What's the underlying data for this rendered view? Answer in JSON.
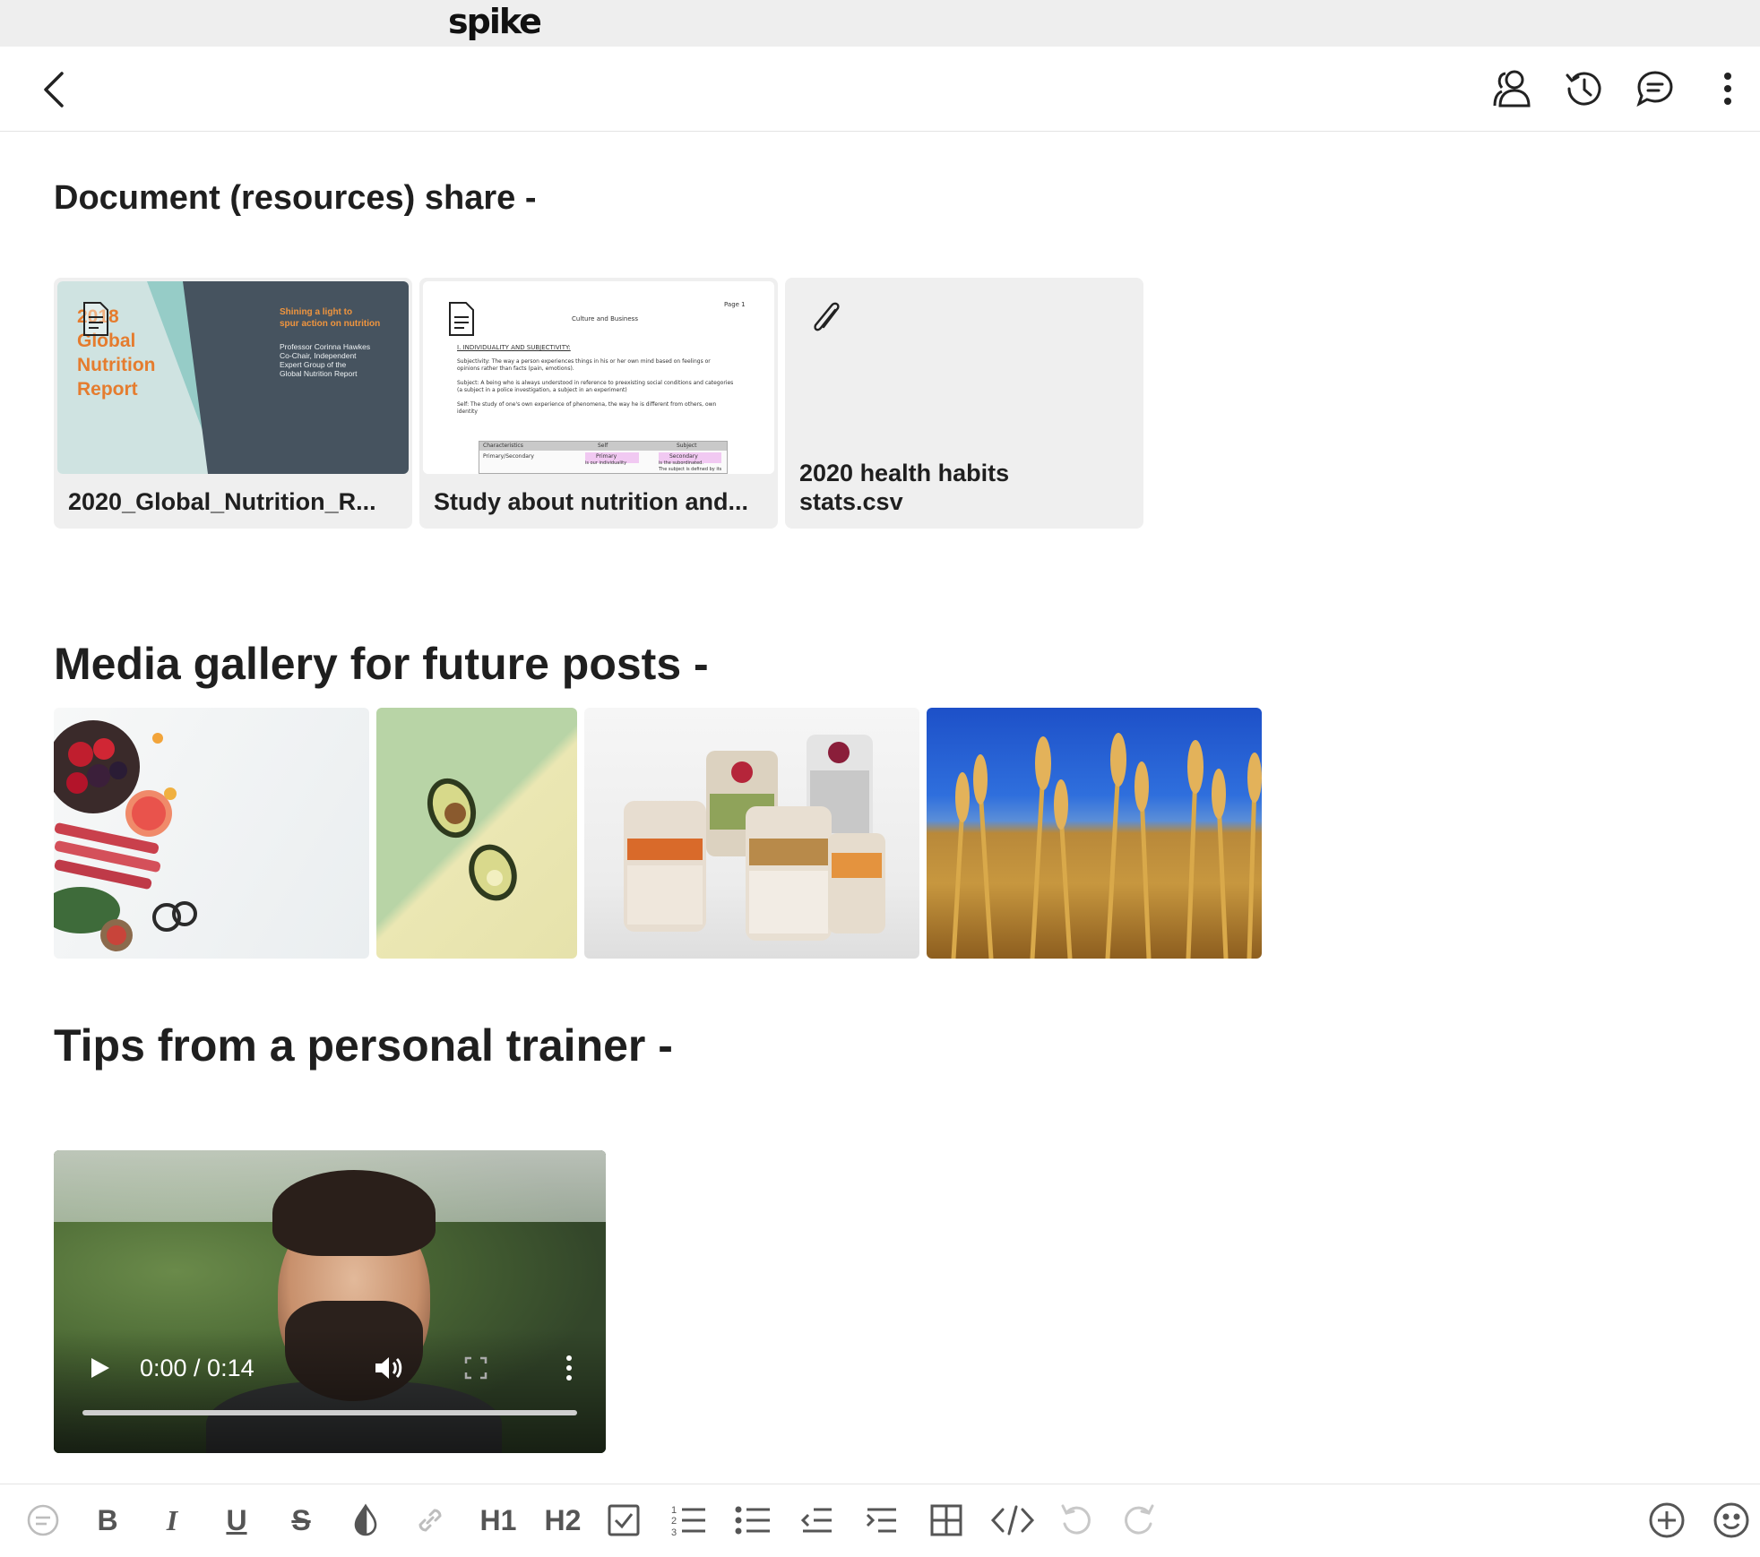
{
  "app": {
    "logo": "spike"
  },
  "header": {
    "back_icon": "chevron-left-icon",
    "actions": [
      "participants-icon",
      "history-icon",
      "comments-icon",
      "more-vertical-icon"
    ]
  },
  "sections": {
    "documents_title": "Document (resources) share -",
    "media_title": "Media gallery for future posts -",
    "tips_title": "Tips from a personal trainer -"
  },
  "files": [
    {
      "name": "2020_Global_Nutrition_R...",
      "preview": {
        "heading_lines": [
          "2018",
          "Global",
          "Nutrition",
          "Report"
        ],
        "tagline_lines": [
          "Shining a light to",
          "spur action on nutrition"
        ],
        "author_lines": [
          "Professor Corinna Hawkes",
          "Co-Chair, Independent",
          "Expert Group of the",
          "Global Nutrition Report"
        ]
      }
    },
    {
      "name": "Study about nutrition and...",
      "preview": {
        "page_label": "Page 1",
        "doc_title": "Culture and Business",
        "heading": "I.    INDIVIDUALITY AND SUBJECTIVITY:",
        "p1": "Subjectivity: The way a person experiences things in his or her own mind based on feelings or",
        "p1b": "opinions rather than facts (pain, emotions).",
        "p2": "Subject: A being who is always understood in reference to preexisting social conditions and categories",
        "p2b": "(a subject in a police investigation, a subject in an experiment)",
        "p3": "Self: The study of one's own experience of phenomena, the way he is different from others, own",
        "p3b": "identity",
        "table_headers": [
          "Characteristics",
          "Self",
          "Subject"
        ],
        "table_row": [
          "Primary/Secondary",
          "Primary",
          "Secondary"
        ],
        "table_row2": [
          "",
          "is our individuality",
          "is the subordinated."
        ],
        "table_row3": [
          "",
          "",
          "The subject is defined by its"
        ]
      }
    },
    {
      "name": "2020 health habits stats.csv"
    }
  ],
  "media": [
    {
      "subject": "berries-and-rhubarb-photo"
    },
    {
      "subject": "avocado-halves-photo"
    },
    {
      "subject": "meal-prep-jars-photo"
    },
    {
      "subject": "wheat-field-photo"
    }
  ],
  "video": {
    "time": "0:00 / 0:14",
    "progress": 0
  },
  "editor_toolbar": {
    "text_buttons": {
      "bold": "B",
      "italic": "I",
      "underline": "U",
      "strike": "S",
      "h1": "H1",
      "h2": "H2"
    },
    "icons": [
      "comment-icon",
      "bold-icon",
      "italic-icon",
      "underline-icon",
      "strikethrough-icon",
      "text-color-icon",
      "link-icon",
      "heading1-icon",
      "heading2-icon",
      "checklist-icon",
      "numbered-list-icon",
      "bulleted-list-icon",
      "outdent-icon",
      "indent-icon",
      "table-icon",
      "code-icon",
      "undo-icon",
      "redo-icon",
      "add-icon",
      "emoji-icon"
    ]
  }
}
